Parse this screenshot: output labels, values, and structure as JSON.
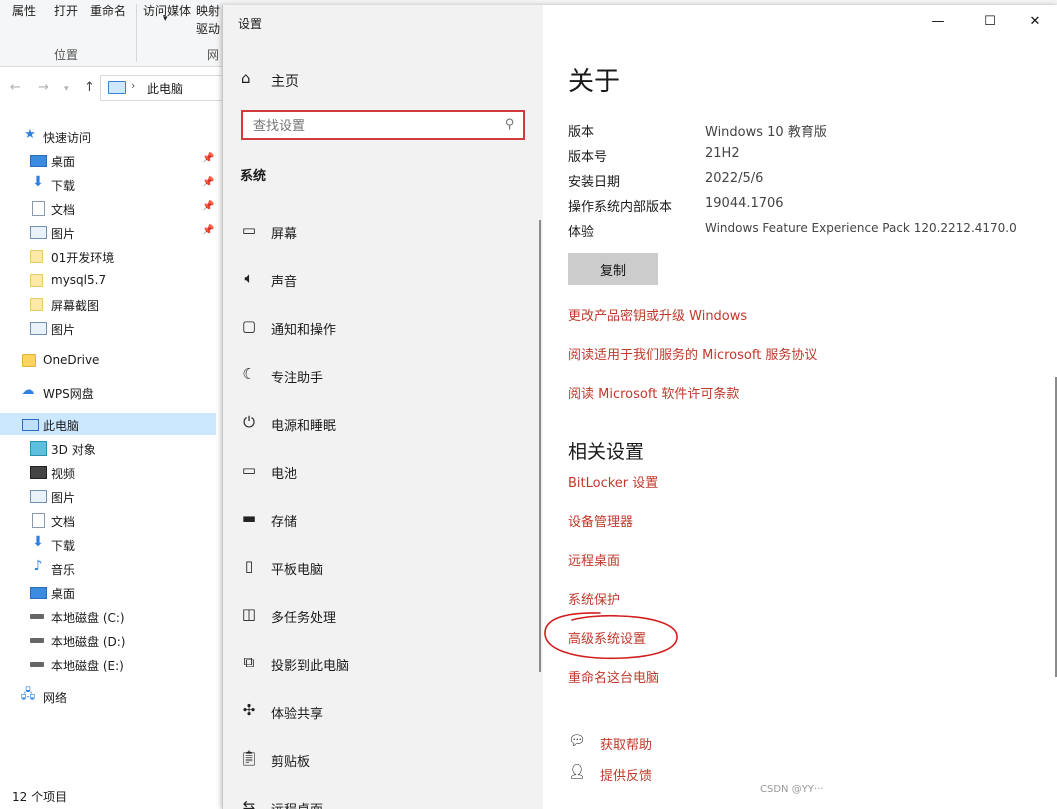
{
  "explorer": {
    "ribbon": {
      "buttons": [
        "属性",
        "打开",
        "重命名",
        "访问媒体",
        "映射",
        "驱动"
      ],
      "group_location": "位置",
      "group_network": "网"
    },
    "address": {
      "back": "←",
      "forward": "→",
      "up": "↑",
      "path": "此电脑"
    },
    "nav": {
      "quick_access": "快速访问",
      "quick_items": [
        {
          "label": "桌面",
          "icon": "desktop-icon",
          "pinned": true
        },
        {
          "label": "下载",
          "icon": "download-icon",
          "pinned": true
        },
        {
          "label": "文档",
          "icon": "document-icon",
          "pinned": true
        },
        {
          "label": "图片",
          "icon": "picture-icon",
          "pinned": true
        },
        {
          "label": "01开发环境",
          "icon": "folder-icon",
          "pinned": false
        },
        {
          "label": "mysql5.7",
          "icon": "folder-icon",
          "pinned": false
        },
        {
          "label": "屏幕截图",
          "icon": "folder-icon",
          "pinned": false
        },
        {
          "label": "图片",
          "icon": "picture-icon",
          "pinned": false
        }
      ],
      "onedrive": "OneDrive",
      "wps": "WPS网盘",
      "this_pc": "此电脑",
      "pc_items": [
        {
          "label": "3D 对象",
          "icon": "cube-icon"
        },
        {
          "label": "视频",
          "icon": "video-icon"
        },
        {
          "label": "图片",
          "icon": "picture-icon"
        },
        {
          "label": "文档",
          "icon": "document-icon"
        },
        {
          "label": "下载",
          "icon": "download-icon"
        },
        {
          "label": "音乐",
          "icon": "music-icon"
        },
        {
          "label": "桌面",
          "icon": "desktop-icon"
        },
        {
          "label": "本地磁盘 (C:)",
          "icon": "drive-icon"
        },
        {
          "label": "本地磁盘 (D:)",
          "icon": "drive-icon"
        },
        {
          "label": "本地磁盘 (E:)",
          "icon": "drive-icon"
        }
      ],
      "network": "网络"
    },
    "status": "12 个项目"
  },
  "settings": {
    "title": "设置",
    "home": "主页",
    "search_placeholder": "查找设置",
    "section": "系统",
    "menu": [
      {
        "label": "屏幕",
        "icon": "monitor-icon"
      },
      {
        "label": "声音",
        "icon": "speaker-icon"
      },
      {
        "label": "通知和操作",
        "icon": "notification-icon"
      },
      {
        "label": "专注助手",
        "icon": "moon-icon"
      },
      {
        "label": "电源和睡眠",
        "icon": "power-icon"
      },
      {
        "label": "电池",
        "icon": "battery-icon"
      },
      {
        "label": "存储",
        "icon": "storage-icon"
      },
      {
        "label": "平板电脑",
        "icon": "tablet-icon"
      },
      {
        "label": "多任务处理",
        "icon": "multitask-icon"
      },
      {
        "label": "投影到此电脑",
        "icon": "project-icon"
      },
      {
        "label": "体验共享",
        "icon": "share-icon"
      },
      {
        "label": "剪贴板",
        "icon": "clipboard-icon"
      },
      {
        "label": "远程桌面",
        "icon": "remote-icon"
      }
    ],
    "window_controls": {
      "minimize": "—",
      "maximize": "☐",
      "close": "✕"
    },
    "about": {
      "heading": "关于",
      "specs": [
        {
          "key": "版本",
          "value": "Windows 10 教育版"
        },
        {
          "key": "版本号",
          "value": "21H2"
        },
        {
          "key": "安装日期",
          "value": "2022/5/6"
        },
        {
          "key": "操作系统内部版本",
          "value": "19044.1706"
        },
        {
          "key": "体验",
          "value": "Windows Feature Experience Pack 120.2212.4170.0"
        }
      ],
      "copy": "复制",
      "links": [
        "更改产品密钥或升级 Windows",
        "阅读适用于我们服务的 Microsoft 服务协议",
        "阅读 Microsoft 软件许可条款"
      ]
    },
    "related": {
      "heading": "相关设置",
      "links": [
        "BitLocker 设置",
        "设备管理器",
        "远程桌面",
        "系统保护",
        "高级系统设置",
        "重命名这台电脑"
      ]
    },
    "help": [
      {
        "label": "获取帮助",
        "icon": "help-chat-icon"
      },
      {
        "label": "提供反馈",
        "icon": "feedback-icon"
      }
    ],
    "watermark": "CSDN @YY···"
  },
  "colors": {
    "link": "#c0392b",
    "annotation": "#d21f1f",
    "selected": "#cce8ff"
  }
}
